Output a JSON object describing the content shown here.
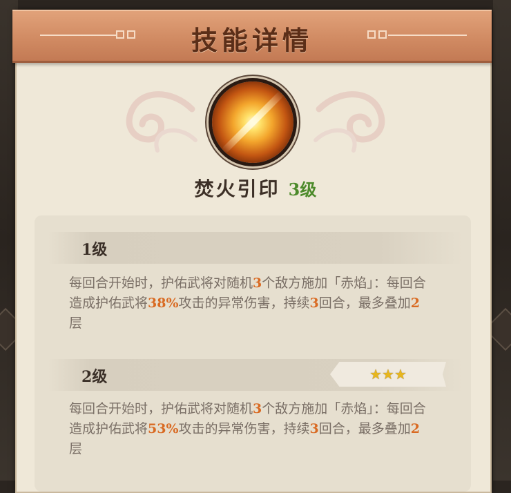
{
  "title": "技能详情",
  "skill": {
    "name": "焚火引印",
    "level": "3级",
    "icon": "fire-seal-icon"
  },
  "levels": [
    {
      "label": "1级",
      "stars": "",
      "desc": {
        "t1": "每回合开始时，护佑武将对随机",
        "v1": "3",
        "t2": "个敌方施加「赤焰」：每回合造成护佑武将",
        "v2": "38%",
        "t3": "攻击的异常伤害，持续",
        "v3": "3",
        "t4": "回合，最多叠加",
        "v4": "2",
        "t5": "层"
      }
    },
    {
      "label": "2级",
      "stars": "★★★",
      "desc": {
        "t1": "每回合开始时，护佑武将对随机",
        "v1": "3",
        "t2": "个敌方施加「赤焰」：每回合造成护佑武将",
        "v2": "53%",
        "t3": "攻击的异常伤害，持续",
        "v3": "3",
        "t4": "回合，最多叠加",
        "v4": "2",
        "t5": "层"
      }
    }
  ],
  "colors": {
    "header": "#d18b63",
    "highlight": "#d96a22",
    "level_text": "#4c8a2a",
    "star": "#e7b61e"
  }
}
